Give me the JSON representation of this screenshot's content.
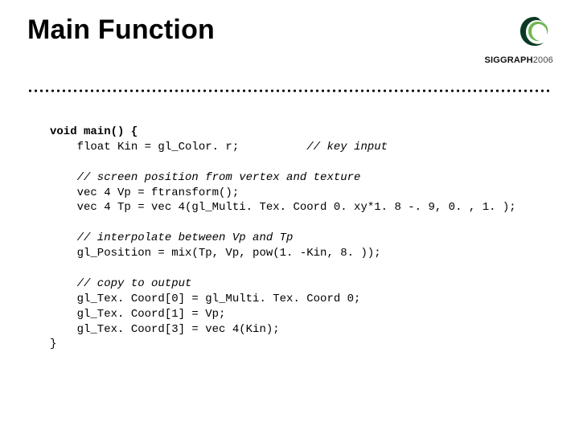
{
  "title": "Main Function",
  "logo": {
    "brand_bold": "SIGGRAPH",
    "brand_light": "2006",
    "colors": {
      "dark": "#0a3a22",
      "light": "#6fb64e"
    }
  },
  "code": {
    "l1a": "void main() {",
    "l2": "    float Kin = gl_Color. r;          ",
    "l2c": "// key input",
    "l4c": "    // screen position from vertex and texture",
    "l5": "    vec 4 Vp = ftransform();",
    "l6": "    vec 4 Tp = vec 4(gl_Multi. Tex. Coord 0. xy*1. 8 -. 9, 0. , 1. );",
    "l8c": "    // interpolate between Vp and Tp",
    "l9": "    gl_Position = mix(Tp, Vp, pow(1. -Kin, 8. ));",
    "l11c": "    // copy to output",
    "l12": "    gl_Tex. Coord[0] = gl_Multi. Tex. Coord 0;",
    "l13": "    gl_Tex. Coord[1] = Vp;",
    "l14": "    gl_Tex. Coord[3] = vec 4(Kin);",
    "l15": "}"
  }
}
